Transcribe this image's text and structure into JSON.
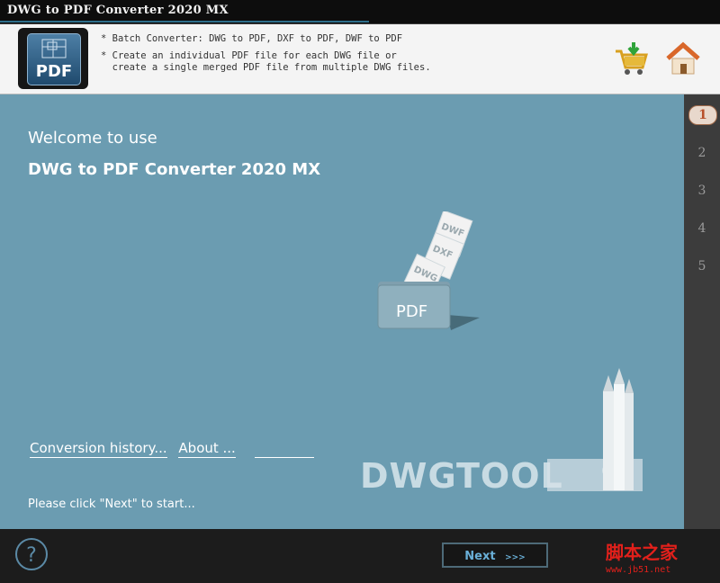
{
  "window": {
    "title": "DWG to PDF Converter 2020 MX"
  },
  "header": {
    "logo_label": "PDF",
    "line1": "* Batch Converter: DWG to PDF, DXF to PDF, DWF to PDF",
    "line2": "* Create an individual PDF file for each DWG file or",
    "line3": "  create a single merged PDF file from multiple DWG files.",
    "icons": [
      "shopping-cart-icon",
      "home-icon"
    ]
  },
  "main": {
    "welcome": "Welcome to use",
    "app_name": "DWG to PDF Converter 2020 MX",
    "illustration": {
      "folder_label": "PDF",
      "pages": [
        "DWG",
        "DXF",
        "DWF"
      ]
    },
    "links": {
      "history": "Conversion history...",
      "about": "About ..."
    },
    "hint": "Please click \"Next\" to start...",
    "brand": "DWGTOOL"
  },
  "steps": [
    "1",
    "2",
    "3",
    "4",
    "5"
  ],
  "active_step": 1,
  "footer": {
    "help_label": "?",
    "next_label": "Next",
    "next_arrows": ">>>",
    "watermark": "脚本之家",
    "watermark_url": "www.jb51.net"
  },
  "colors": {
    "panel": "#6b9cb1",
    "accent": "#6ab0d8",
    "step_active": "#b8502a"
  }
}
